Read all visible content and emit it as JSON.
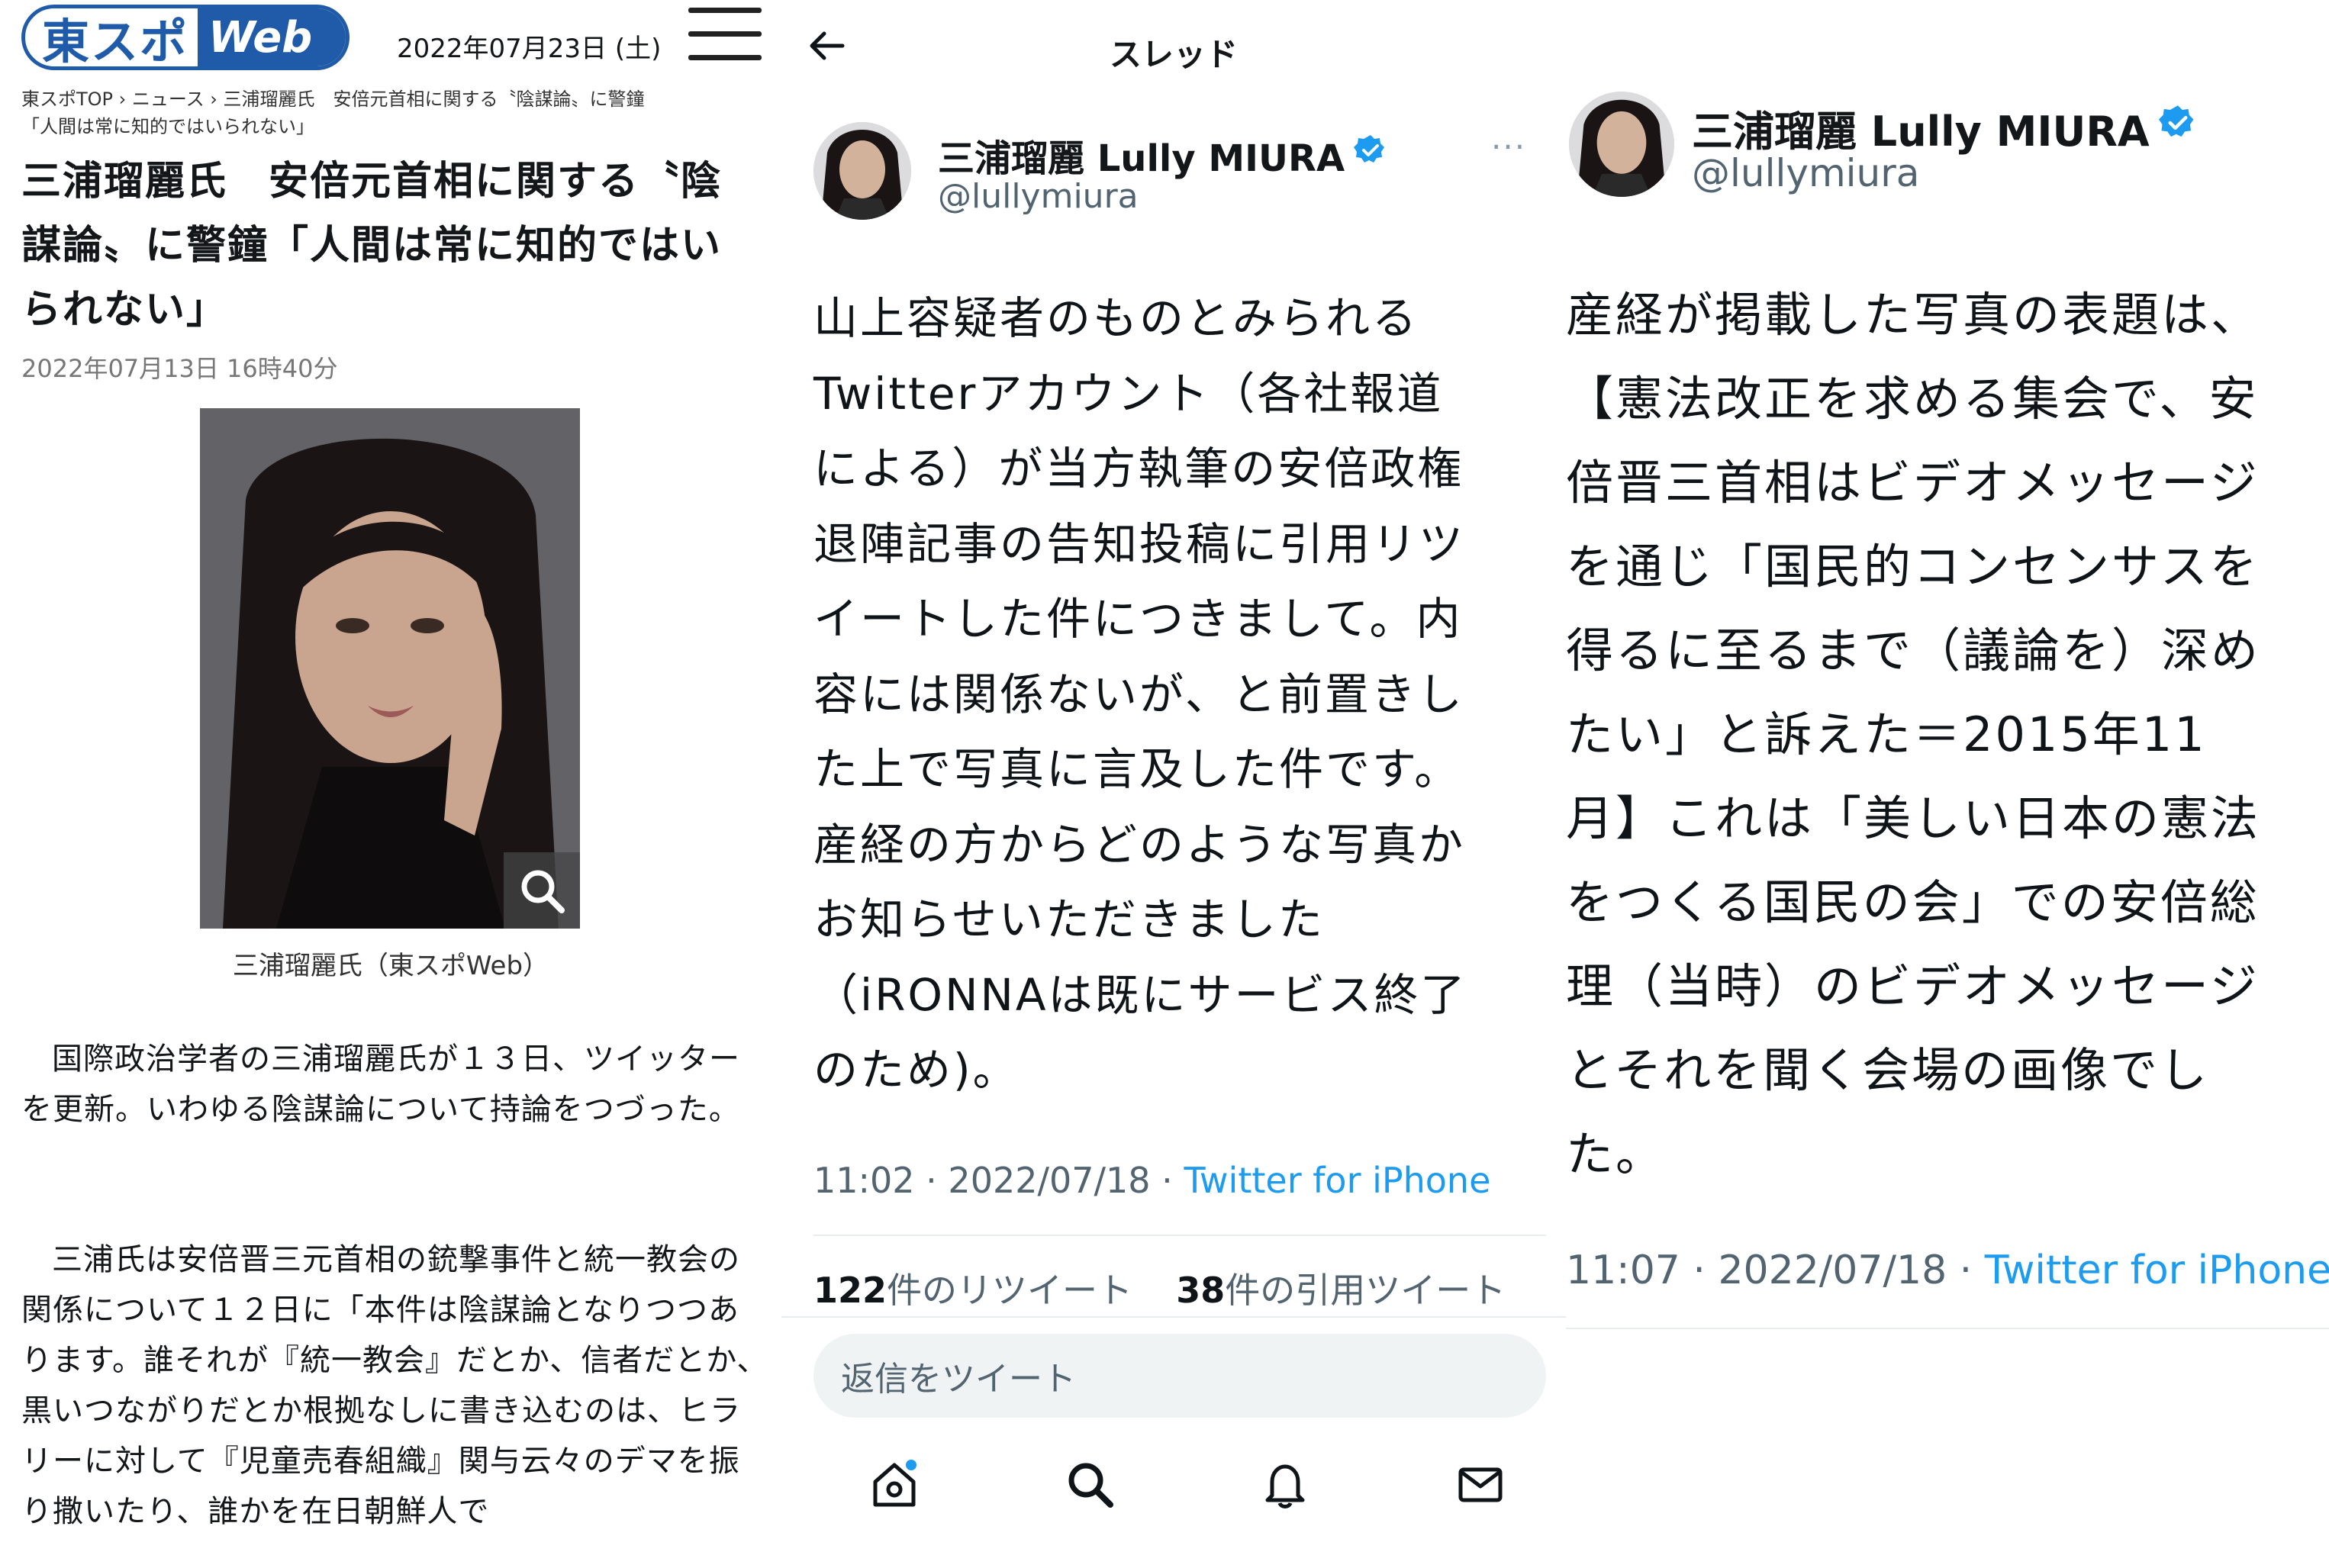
{
  "article": {
    "logo_jp": "東スポ",
    "logo_web": "Web",
    "date_top": "2022年07月23日 (土)",
    "breadcrumb_1": "東スポTOP › ニュース › 三浦瑠麗氏　安倍元首相に関する〝陰謀論〟に警鐘",
    "breadcrumb_2": "「人間は常に知的ではいられない」",
    "title": "三浦瑠麗氏　安倍元首相に関する〝陰謀論〟に警鐘「人間は常に知的ではいられない」",
    "published": "2022年07月13日 16時40分",
    "photo_caption": "三浦瑠麗氏（東スポWeb）",
    "paragraph_1": "国際政治学者の三浦瑠麗氏が１３日、ツイッターを更新。いわゆる陰謀論について持論をつづった。",
    "paragraph_2": "三浦氏は安倍晋三元首相の銃撃事件と統一教会の関係について１２日に「本件は陰謀論となりつつあります。誰それが『統一教会』だとか、信者だとか、黒いつながりだとか根拠なしに書き込むのは、ヒラリーに対して『児童売春組織』関与云々のデマを振り撒いたり、誰かを在日朝鮮人で"
  },
  "thread": {
    "header_title": "スレッド",
    "author_name": "三浦瑠麗 Lully MIURA",
    "author_handle": "@lullymiura",
    "more": "···",
    "tweet_text": "山上容疑者のものとみられる\nTwitterアカウント（各社報道\nによる）が当方執筆の安倍政権\n退陣記事の告知投稿に引用リツ\nイートした件につきまして。内\n容には関係ないが、と前置きし\nた上で写真に言及した件です。\n産経の方からどのような写真か\nお知らせいただきました\n（iRONNAは既にサービス終了\nのため)。",
    "time": "11:02 · 2022/07/18 · ",
    "source": "Twitter for iPhone",
    "retweets_count": "122",
    "retweets_label": "件のリツイート",
    "quotes_count": "38",
    "quotes_label": "件の引用ツイート",
    "reply_placeholder": "返信をツイート"
  },
  "continuation": {
    "author_name": "三浦瑠麗 Lully MIURA",
    "author_handle": "@lullymiura",
    "tweet_text": "産経が掲載した写真の表題は、\n【憲法改正を求める集会で、安\n倍晋三首相はビデオメッセージ\nを通じ「国民的コンセンサスを\n得るに至るまで（議論を）深め\nたい」と訴えた＝2015年11\n月】これは「美しい日本の憲法\nをつくる国民の会」での安倍総\n理（当時）のビデオメッセージ\nとそれを聞く会場の画像でし\nた。",
    "time": "11:07 · 2022/07/18 · ",
    "source": "Twitter for iPhone"
  },
  "colors": {
    "brand_blue": "#1f5ba8",
    "twitter_blue": "#1d9bf0",
    "muted": "#536471"
  },
  "icons": [
    "hamburger-menu-icon",
    "zoom-icon",
    "back-arrow-icon",
    "verified-badge-icon",
    "home-icon",
    "search-icon",
    "bell-icon",
    "mail-icon"
  ]
}
